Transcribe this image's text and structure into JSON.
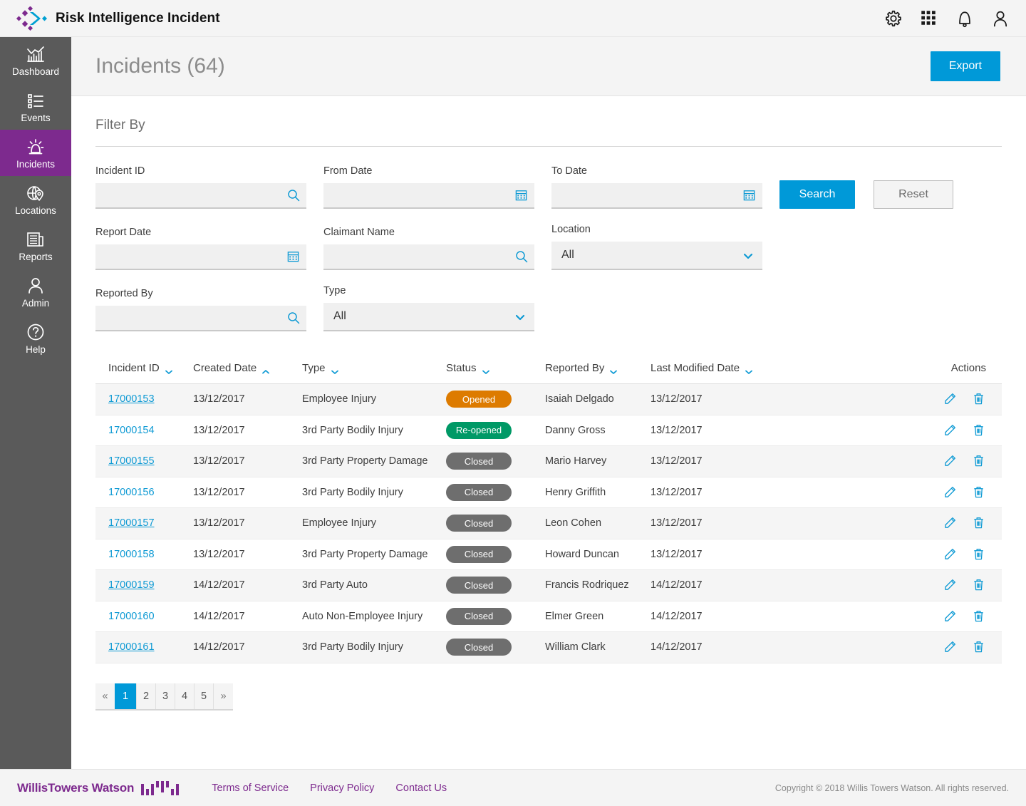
{
  "header": {
    "brand_title": "Risk Intelligence Incident",
    "icons": [
      {
        "name": "gear-icon",
        "label": "Settings"
      },
      {
        "name": "apps-grid-icon",
        "label": "Apps"
      },
      {
        "name": "bell-icon",
        "label": "Notifications"
      },
      {
        "name": "user-icon",
        "label": "Account"
      }
    ]
  },
  "sidebar": {
    "items": [
      {
        "label": "Dashboard",
        "icon": "chart-bars-icon",
        "active": false
      },
      {
        "label": "Events",
        "icon": "list-icon",
        "active": false
      },
      {
        "label": "Incidents",
        "icon": "siren-icon",
        "active": true
      },
      {
        "label": "Locations",
        "icon": "globe-pin-icon",
        "active": false
      },
      {
        "label": "Reports",
        "icon": "newspaper-icon",
        "active": false
      },
      {
        "label": "Admin",
        "icon": "person-icon",
        "active": false
      },
      {
        "label": "Help",
        "icon": "question-circle-icon",
        "active": false
      }
    ]
  },
  "page": {
    "title": "Incidents (64)",
    "export_label": "Export"
  },
  "filter": {
    "heading": "Filter By",
    "search_label": "Search",
    "reset_label": "Reset",
    "fields": {
      "incident_id": {
        "label": "Incident ID",
        "value": "",
        "placeholder": "",
        "icon": "search-icon"
      },
      "from_date": {
        "label": "From Date",
        "value": "",
        "placeholder": "",
        "icon": "calendar-icon"
      },
      "to_date": {
        "label": "To Date",
        "value": "",
        "placeholder": "",
        "icon": "calendar-icon"
      },
      "report_date": {
        "label": "Report Date",
        "value": "",
        "placeholder": "",
        "icon": "calendar-icon"
      },
      "claimant_name": {
        "label": "Claimant Name",
        "value": "",
        "placeholder": "",
        "icon": "search-icon"
      },
      "location": {
        "label": "Location",
        "value": "All",
        "options": [
          "All"
        ]
      },
      "reported_by": {
        "label": "Reported By",
        "value": "",
        "placeholder": "",
        "icon": "search-icon"
      },
      "type": {
        "label": "Type",
        "value": "All",
        "options": [
          "All"
        ]
      }
    }
  },
  "table": {
    "columns": [
      {
        "label": "Incident ID",
        "sort": "down"
      },
      {
        "label": "Created Date",
        "sort": "up"
      },
      {
        "label": "Type",
        "sort": "down"
      },
      {
        "label": "Status",
        "sort": "down"
      },
      {
        "label": "Reported By",
        "sort": "down"
      },
      {
        "label": "Last Modified Date",
        "sort": "down"
      },
      {
        "label": "Actions",
        "sort": "none"
      }
    ],
    "rows": [
      {
        "id": "17000153",
        "created": "13/12/2017",
        "type": "Employee Injury",
        "status": "Opened",
        "status_kind": "opened",
        "reported_by": "Isaiah Delgado",
        "modified": "13/12/2017"
      },
      {
        "id": "17000154",
        "created": "13/12/2017",
        "type": "3rd Party Bodily Injury",
        "status": "Re-opened",
        "status_kind": "reopened",
        "reported_by": "Danny Gross",
        "modified": "13/12/2017"
      },
      {
        "id": "17000155",
        "created": "13/12/2017",
        "type": "3rd Party Property Damage",
        "status": "Closed",
        "status_kind": "closed",
        "reported_by": "Mario Harvey",
        "modified": "13/12/2017"
      },
      {
        "id": "17000156",
        "created": "13/12/2017",
        "type": "3rd Party Bodily Injury",
        "status": "Closed",
        "status_kind": "closed",
        "reported_by": "Henry Griffith",
        "modified": "13/12/2017"
      },
      {
        "id": "17000157",
        "created": "13/12/2017",
        "type": "Employee Injury",
        "status": "Closed",
        "status_kind": "closed",
        "reported_by": "Leon Cohen",
        "modified": "13/12/2017"
      },
      {
        "id": "17000158",
        "created": "13/12/2017",
        "type": "3rd Party Property Damage",
        "status": "Closed",
        "status_kind": "closed",
        "reported_by": "Howard Duncan",
        "modified": "13/12/2017"
      },
      {
        "id": "17000159",
        "created": "14/12/2017",
        "type": "3rd Party Auto",
        "status": "Closed",
        "status_kind": "closed",
        "reported_by": "Francis Rodriquez",
        "modified": "14/12/2017"
      },
      {
        "id": "17000160",
        "created": "14/12/2017",
        "type": "Auto Non-Employee Injury",
        "status": "Closed",
        "status_kind": "closed",
        "reported_by": "Elmer Green",
        "modified": "14/12/2017"
      },
      {
        "id": "17000161",
        "created": "14/12/2017",
        "type": "3rd Party Bodily Injury",
        "status": "Closed",
        "status_kind": "closed",
        "reported_by": "William Clark",
        "modified": "14/12/2017"
      }
    ],
    "action_icons": [
      "edit-pencil-icon",
      "delete-trash-icon"
    ]
  },
  "pagination": {
    "prev": "«",
    "next": "»",
    "pages": [
      "1",
      "2",
      "3",
      "4",
      "5"
    ],
    "current": "1"
  },
  "footer": {
    "company": "WillisTowers Watson",
    "links": [
      "Terms of Service",
      "Privacy Policy",
      "Contact Us"
    ],
    "copyright": "Copyright © 2018 Willis Towers Watson. All rights reserved."
  },
  "colors": {
    "accent_blue": "#0099d8",
    "brand_purple": "#7d2a8e",
    "sidebar_bg": "#5a5a5a",
    "status_opened": "#dd7b00",
    "status_reopened": "#009966",
    "status_closed": "#6e6e6e"
  }
}
